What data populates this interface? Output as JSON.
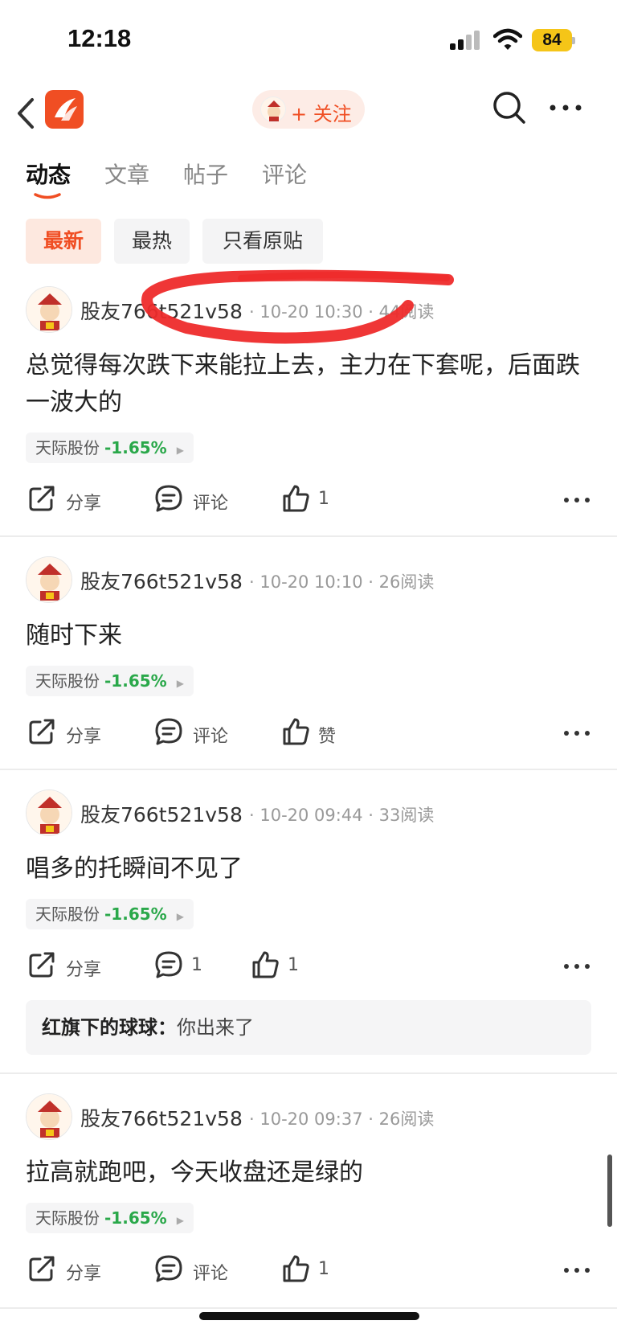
{
  "status_bar": {
    "time": "12:18",
    "battery": "84"
  },
  "header": {
    "follow_label": "+ 关注"
  },
  "tabs": [
    {
      "label": "动态",
      "active": true
    },
    {
      "label": "文章",
      "active": false
    },
    {
      "label": "帖子",
      "active": false
    },
    {
      "label": "评论",
      "active": false
    }
  ],
  "filters": [
    {
      "label": "最新",
      "active": true
    },
    {
      "label": "最热",
      "active": false
    },
    {
      "label": "只看原贴",
      "active": false
    }
  ],
  "posts": [
    {
      "author": "股友766t521v58",
      "datetime": "10-20 10:30",
      "reads": "44阅读",
      "content": "总觉得每次跌下来能拉上去，主力在下套呢，后面跌一波大的",
      "stock_name": "天际股份",
      "stock_change": "-1.65%",
      "share_label": "分享",
      "comment_label": "评论",
      "like_label": "1"
    },
    {
      "author": "股友766t521v58",
      "datetime": "10-20 10:10",
      "reads": "26阅读",
      "content": "随时下来",
      "stock_name": "天际股份",
      "stock_change": "-1.65%",
      "share_label": "分享",
      "comment_label": "评论",
      "like_label": "赞"
    },
    {
      "author": "股友766t521v58",
      "datetime": "10-20 09:44",
      "reads": "33阅读",
      "content": "唱多的托瞬间不见了",
      "stock_name": "天际股份",
      "stock_change": "-1.65%",
      "share_label": "分享",
      "comment_label": "1",
      "like_label": "1",
      "comment_preview": {
        "user": "红旗下的球球：",
        "text": "你出来了"
      }
    },
    {
      "author": "股友766t521v58",
      "datetime": "10-20 09:37",
      "reads": "26阅读",
      "content": "拉高就跑吧，今天收盘还是绿的",
      "stock_name": "天际股份",
      "stock_change": "-1.65%",
      "share_label": "分享",
      "comment_label": "评论",
      "like_label": "1"
    }
  ],
  "colors": {
    "accent": "#f04e23",
    "stock_down": "#2aa84a",
    "annotation": "#ee2b2b"
  }
}
